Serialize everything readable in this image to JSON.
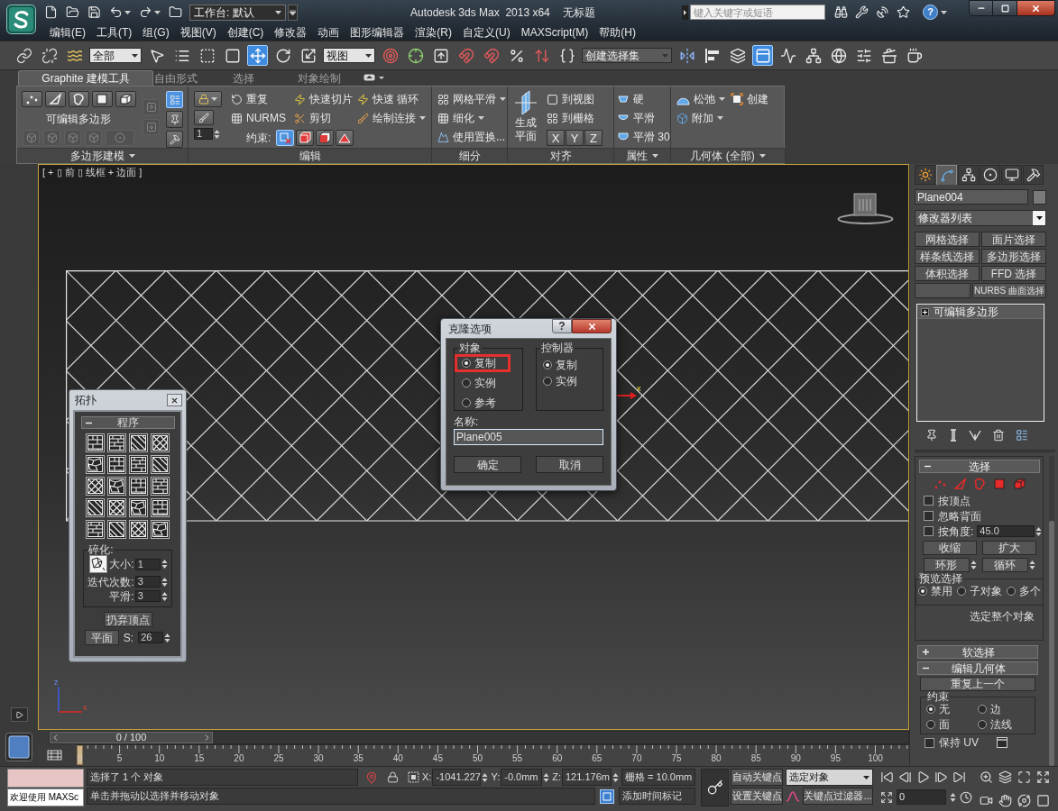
{
  "title_bar": {
    "workspace": "工作台: 默认",
    "title": "Autodesk 3ds Max  2013 x64",
    "document": "无标题",
    "search": {
      "placeholder": "键入关键字或短语"
    },
    "help": "?"
  },
  "menu": [
    "编辑(E)",
    "工具(T)",
    "组(G)",
    "视图(V)",
    "创建(C)",
    "修改器",
    "动画",
    "图形编辑器",
    "渲染(R)",
    "自定义(U)",
    "MAXScript(M)",
    "帮助(H)"
  ],
  "main_toolbar": [
    {
      "kind": "icon",
      "selected": false
    },
    {
      "kind": "icon",
      "selected": false
    },
    {
      "kind": "icon",
      "selected": false
    },
    {
      "kind": "dropdown",
      "value": "全部"
    },
    {
      "kind": "icon",
      "selected": false
    },
    {
      "kind": "icon",
      "selected": false
    },
    {
      "kind": "icon",
      "selected": false
    },
    {
      "kind": "icon",
      "selected": false
    },
    {
      "kind": "icon",
      "selected": true
    },
    {
      "kind": "icon",
      "selected": false
    },
    {
      "kind": "icon",
      "selected": false
    },
    {
      "kind": "dropdown",
      "value": "视图"
    },
    {
      "kind": "icon",
      "selected": false
    },
    {
      "kind": "icon",
      "selected": false
    },
    {
      "kind": "icon",
      "selected": false
    },
    {
      "kind": "icon",
      "selected": false
    },
    {
      "kind": "icon",
      "selected": false
    },
    {
      "kind": "icon",
      "selected": false
    },
    {
      "kind": "icon",
      "selected": false
    },
    {
      "kind": "icon",
      "selected": false
    },
    {
      "kind": "dropdown",
      "value": "创建选择集"
    },
    {
      "kind": "icon",
      "selected": false
    },
    {
      "kind": "icon",
      "selected": false
    },
    {
      "kind": "icon",
      "selected": false
    },
    {
      "kind": "icon",
      "selected": true
    },
    {
      "kind": "icon",
      "selected": false
    },
    {
      "kind": "icon",
      "selected": false
    },
    {
      "kind": "icon",
      "selected": false
    },
    {
      "kind": "icon",
      "selected": false
    },
    {
      "kind": "icon",
      "selected": false
    },
    {
      "kind": "icon",
      "selected": false
    }
  ],
  "ribbon": {
    "tabs": [
      {
        "label": "Graphite 建模工具",
        "selected": true
      },
      {
        "label": "自由形式",
        "selected": false
      },
      {
        "label": "选择",
        "selected": false
      },
      {
        "label": "对象绘制",
        "selected": false
      }
    ],
    "polygon_modeling": {
      "title": "多边形建模",
      "has_menu": true,
      "label": "可编辑多边形",
      "modify_buttons": [
        {
          "disabled": true
        },
        {
          "disabled": true
        },
        {
          "disabled": true
        },
        {
          "disabled": true
        },
        {
          "disabled": true
        }
      ],
      "stack_buttons": [
        {
          "disabled": true
        },
        {
          "disabled": true
        }
      ],
      "mode_buttons": [
        {
          "selected": true
        },
        {
          "selected": false
        },
        {
          "selected": false
        }
      ]
    },
    "edit": {
      "title": "编辑",
      "has_menu": false,
      "spinner": "1",
      "items": [
        {
          "label": "重复",
          "has_menu": false
        },
        {
          "label": "快速切片",
          "has_menu": false
        },
        {
          "label": "快速 循环",
          "has_menu": false
        },
        {
          "label": "NURMS",
          "has_menu": false
        },
        {
          "label": "剪切",
          "has_menu": false
        },
        {
          "label": "绘制连接",
          "has_menu": true
        }
      ],
      "constraint_label": "约束:",
      "constraints": [
        {
          "selected": true
        },
        {
          "selected": false
        },
        {
          "selected": false
        },
        {
          "selected": false
        }
      ]
    },
    "subdivision": {
      "title": "细分",
      "has_menu": false,
      "items": [
        {
          "label": "网格平滑",
          "has_menu": true
        },
        {
          "label": "细化",
          "has_menu": true
        },
        {
          "label": "使用置换...",
          "has_menu": false
        }
      ]
    },
    "align": {
      "title": "对齐",
      "has_menu": false,
      "big_button": "生成平面",
      "items": [
        "到视图",
        "到栅格"
      ],
      "axes": [
        "X",
        "Y",
        "Z"
      ]
    },
    "properties": {
      "title": "属性",
      "has_menu": true,
      "items": [
        "硬",
        "平滑",
        "平滑 30"
      ]
    },
    "geometry": {
      "title": "几何体 (全部)",
      "has_menu": true,
      "items": [
        {
          "label": "松弛",
          "has_menu": true
        },
        {
          "label": "创建",
          "has_menu": false
        },
        {
          "label": "附加",
          "has_menu": true
        }
      ]
    }
  },
  "viewport": {
    "label": "[ + ▯ 前 ▯ 线框 + 边面 ]",
    "active": true,
    "gizmo_axis": "x",
    "axis_labels": [
      "z",
      "x"
    ]
  },
  "topology": {
    "title": "拓扑",
    "rollout": {
      "title": "程序",
      "expanded": true
    },
    "fracture": {
      "title": "碎化:",
      "fields": [
        {
          "label": "大小:",
          "value": "1"
        },
        {
          "label": "迭代次数:",
          "value": "3"
        },
        {
          "label": "平滑:",
          "value": "3"
        }
      ]
    },
    "discard_button": "扔弃顶点",
    "planar_button": "平面",
    "s_field": {
      "label": "S:",
      "value": "26"
    }
  },
  "clone_dialog": {
    "title": "克隆选项",
    "help": "?",
    "object": {
      "title": "对象",
      "options": [
        {
          "label": "复制",
          "selected": true,
          "highlighted": true
        },
        {
          "label": "实例",
          "selected": false,
          "highlighted": false
        },
        {
          "label": "参考",
          "selected": false,
          "highlighted": false
        }
      ]
    },
    "controller": {
      "title": "控制器",
      "options": [
        {
          "label": "复制",
          "selected": true
        },
        {
          "label": "实例",
          "selected": false
        }
      ]
    },
    "name": {
      "label": "名称:",
      "value": "Plane005"
    },
    "buttons": [
      "确定",
      "取消"
    ]
  },
  "timeline": {
    "frame_label": "0 / 100",
    "level": 0,
    "ticks": [
      "0",
      "5",
      "10",
      "15",
      "20",
      "25",
      "30",
      "35",
      "40",
      "45",
      "50",
      "55",
      "60",
      "65",
      "70",
      "75",
      "80",
      "85",
      "90",
      "95",
      "100"
    ]
  },
  "command_panel": {
    "tabs": [
      {
        "selected": false
      },
      {
        "selected": true
      },
      {
        "selected": false
      },
      {
        "selected": false
      },
      {
        "selected": false
      },
      {
        "selected": false
      }
    ],
    "object_name": "Plane004",
    "modifier_list": "修改器列表",
    "modifier_buttons": [
      "网格选择",
      "面片选择",
      "样条线选择",
      "多边形选择",
      "体积选择",
      "FFD 选择",
      "NURBS 曲面选择"
    ],
    "stack": [
      {
        "label": "可编辑多边形",
        "expanded": false
      }
    ],
    "selection": {
      "title": "选择",
      "expanded": true,
      "checkboxes": [
        {
          "label": "按顶点",
          "checked": false
        },
        {
          "label": "忽略背面",
          "checked": false
        },
        {
          "label": "按角度:",
          "checked": false
        }
      ],
      "angle": "45.0",
      "buttons": [
        "收缩",
        "扩大"
      ],
      "spinner_buttons": [
        "环形",
        "循环"
      ],
      "preview": {
        "title": "预览选择",
        "options": [
          {
            "label": "禁用",
            "selected": true
          },
          {
            "label": "子对象",
            "selected": false
          },
          {
            "label": "多个",
            "selected": false
          }
        ]
      },
      "select_whole": "选定整个对象"
    },
    "soft_selection": {
      "title": "软选择",
      "expanded": false
    },
    "edit_geometry": {
      "title": "编辑几何体",
      "expanded": true,
      "repeat_last": "重复上一个",
      "constraints": {
        "title": "约束",
        "options": [
          {
            "label": "无",
            "selected": true
          },
          {
            "label": "边",
            "selected": false
          },
          {
            "label": "面",
            "selected": false
          },
          {
            "label": "法线",
            "selected": false
          }
        ]
      },
      "preserve_uv": {
        "label": "保持 UV",
        "checked": false
      }
    }
  },
  "status_bar": {
    "listener": "欢迎使用 MAXSc",
    "message": "选择了 1 个 对象",
    "prompt": "单击并拖动以选择并移动对象",
    "coords": [
      {
        "label": "X:",
        "value": "-1041.227"
      },
      {
        "label": "Y:",
        "value": "-0.0mm"
      },
      {
        "label": "Z:",
        "value": "121.176m"
      }
    ],
    "grid": "栅格 = 10.0mm",
    "time_tag": "添加时间标记",
    "auto_key": "自动关键点",
    "key_target": "选定对象",
    "set_key": "设置关键点",
    "key_filters": "关键点过滤器...",
    "frame": "0"
  }
}
